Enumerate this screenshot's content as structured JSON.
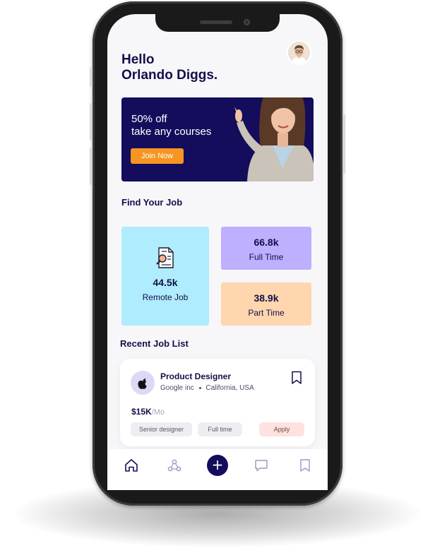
{
  "header": {
    "greeting_line1": "Hello",
    "greeting_line2": "Orlando Diggs."
  },
  "promo": {
    "line1": "50% off",
    "line2": "take any courses",
    "button_label": "Join Now"
  },
  "find_job": {
    "title": "Find Your Job",
    "cards": [
      {
        "value": "44.5k",
        "label": "Remote Job",
        "color": "#afecfe"
      },
      {
        "value": "66.8k",
        "label": "Full Time",
        "color": "#beafff"
      },
      {
        "value": "38.9k",
        "label": "Part Time",
        "color": "#ffd6ad"
      }
    ]
  },
  "recent": {
    "title": "Recent Job List",
    "job": {
      "title": "Product Designer",
      "company": "Google inc",
      "location": "California, USA",
      "salary": "$15K",
      "salary_unit": "/Mo",
      "tags": [
        "Senior designer",
        "Full time"
      ],
      "apply_label": "Apply"
    }
  },
  "nav": {
    "items": [
      "home-icon",
      "connection-icon",
      "add-icon",
      "chat-icon",
      "bookmark-icon"
    ],
    "fab_symbol": "+"
  },
  "colors": {
    "primary": "#130d5c",
    "accent": "#f79521",
    "text": "#130f4a"
  }
}
